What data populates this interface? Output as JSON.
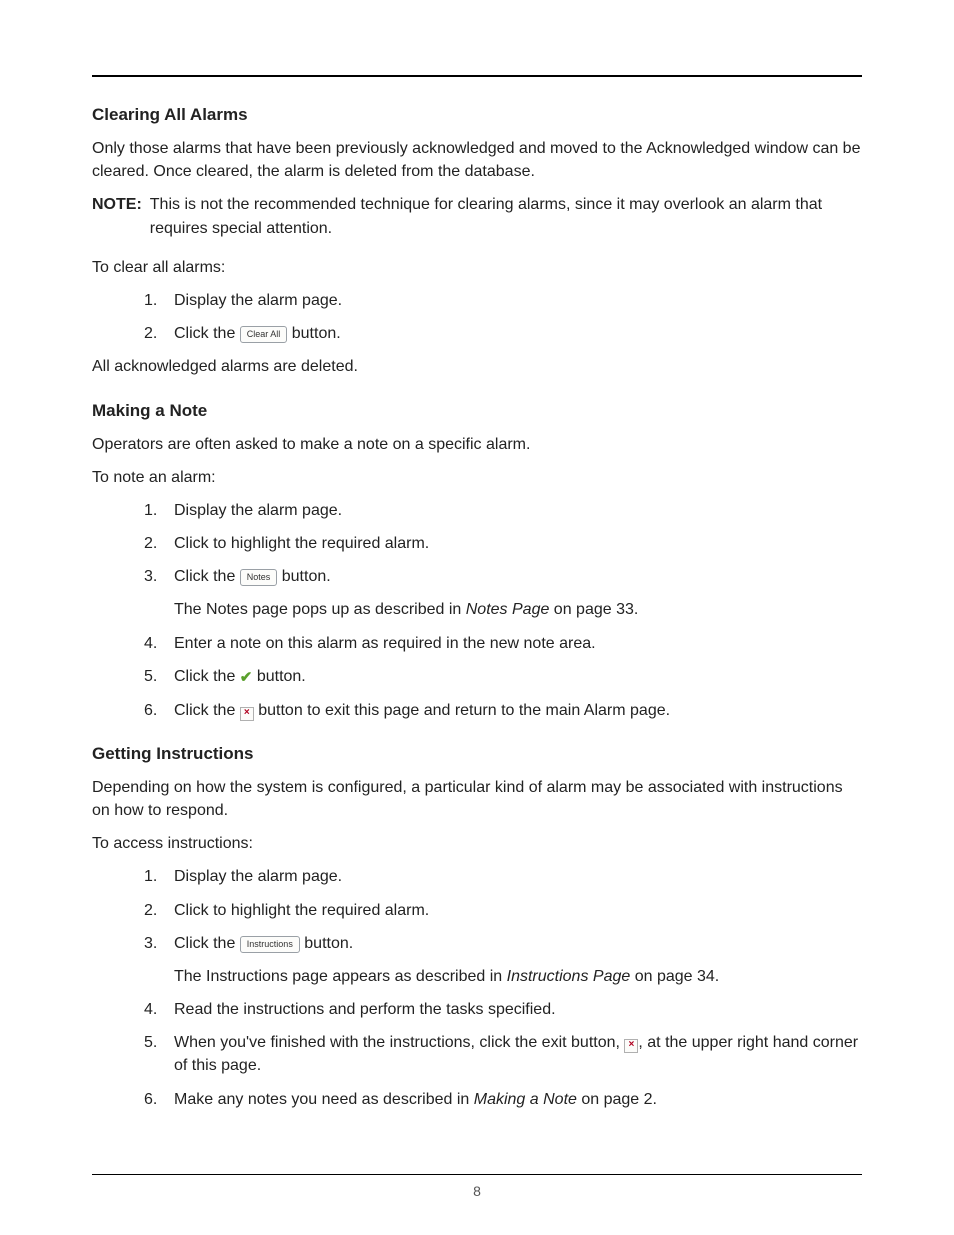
{
  "pageNumber": "8",
  "s1": {
    "heading": "Clearing All Alarms",
    "intro": "Only those alarms that have been previously acknowledged and moved to the Acknowledged window can be cleared. Once cleared, the alarm is deleted from the database.",
    "noteLabel": "NOTE:",
    "noteText": "This is not the recommended technique for clearing alarms, since it may overlook an alarm that requires special attention.",
    "lead": "To clear all alarms:",
    "steps": {
      "n1": "1.",
      "t1": "Display the alarm page.",
      "n2": "2.",
      "t2a": "Click the ",
      "btn2": "Clear All",
      "t2b": " button."
    },
    "outro": "All acknowledged alarms are deleted."
  },
  "s2": {
    "heading": "Making a Note",
    "intro": "Operators are often asked to make a note on a specific alarm.",
    "lead": "To note an alarm:",
    "steps": {
      "n1": "1.",
      "t1": "Display the alarm page.",
      "n2": "2.",
      "t2": "Click to highlight the required alarm.",
      "n3": "3.",
      "t3a": "Click the ",
      "btn3": "Notes",
      "t3b": " button.",
      "sub3a": "The Notes page pops up as described in ",
      "sub3i": "Notes Page",
      "sub3b": " on page 33.",
      "n4": "4.",
      "t4": "Enter a note on this alarm as required in the new note area.",
      "n5": "5.",
      "t5a": "Click the ",
      "t5b": " button.",
      "n6": "6.",
      "t6a": "Click the ",
      "t6b": " button to exit this page and return to the main Alarm page."
    }
  },
  "s3": {
    "heading": "Getting Instructions",
    "intro": "Depending on how the system is configured, a particular kind of alarm may be associated with instructions on how to respond.",
    "lead": "To access instructions:",
    "steps": {
      "n1": "1.",
      "t1": "Display the alarm page.",
      "n2": "2.",
      "t2": "Click to highlight the required alarm.",
      "n3": "3.",
      "t3a": "Click the ",
      "btn3": "Instructions",
      "t3b": " button.",
      "sub3a": "The Instructions page appears as described in ",
      "sub3i": "Instructions Page",
      "sub3b": " on page 34.",
      "n4": "4.",
      "t4": "Read the instructions and perform the tasks specified.",
      "n5": "5.",
      "t5a": "When you've finished with the instructions, click the exit button, ",
      "t5b": ", at the upper right hand corner of this page.",
      "n6": "6.",
      "t6a": "Make any notes you need as described in ",
      "t6i": "Making a Note",
      "t6b": " on page 2."
    }
  }
}
